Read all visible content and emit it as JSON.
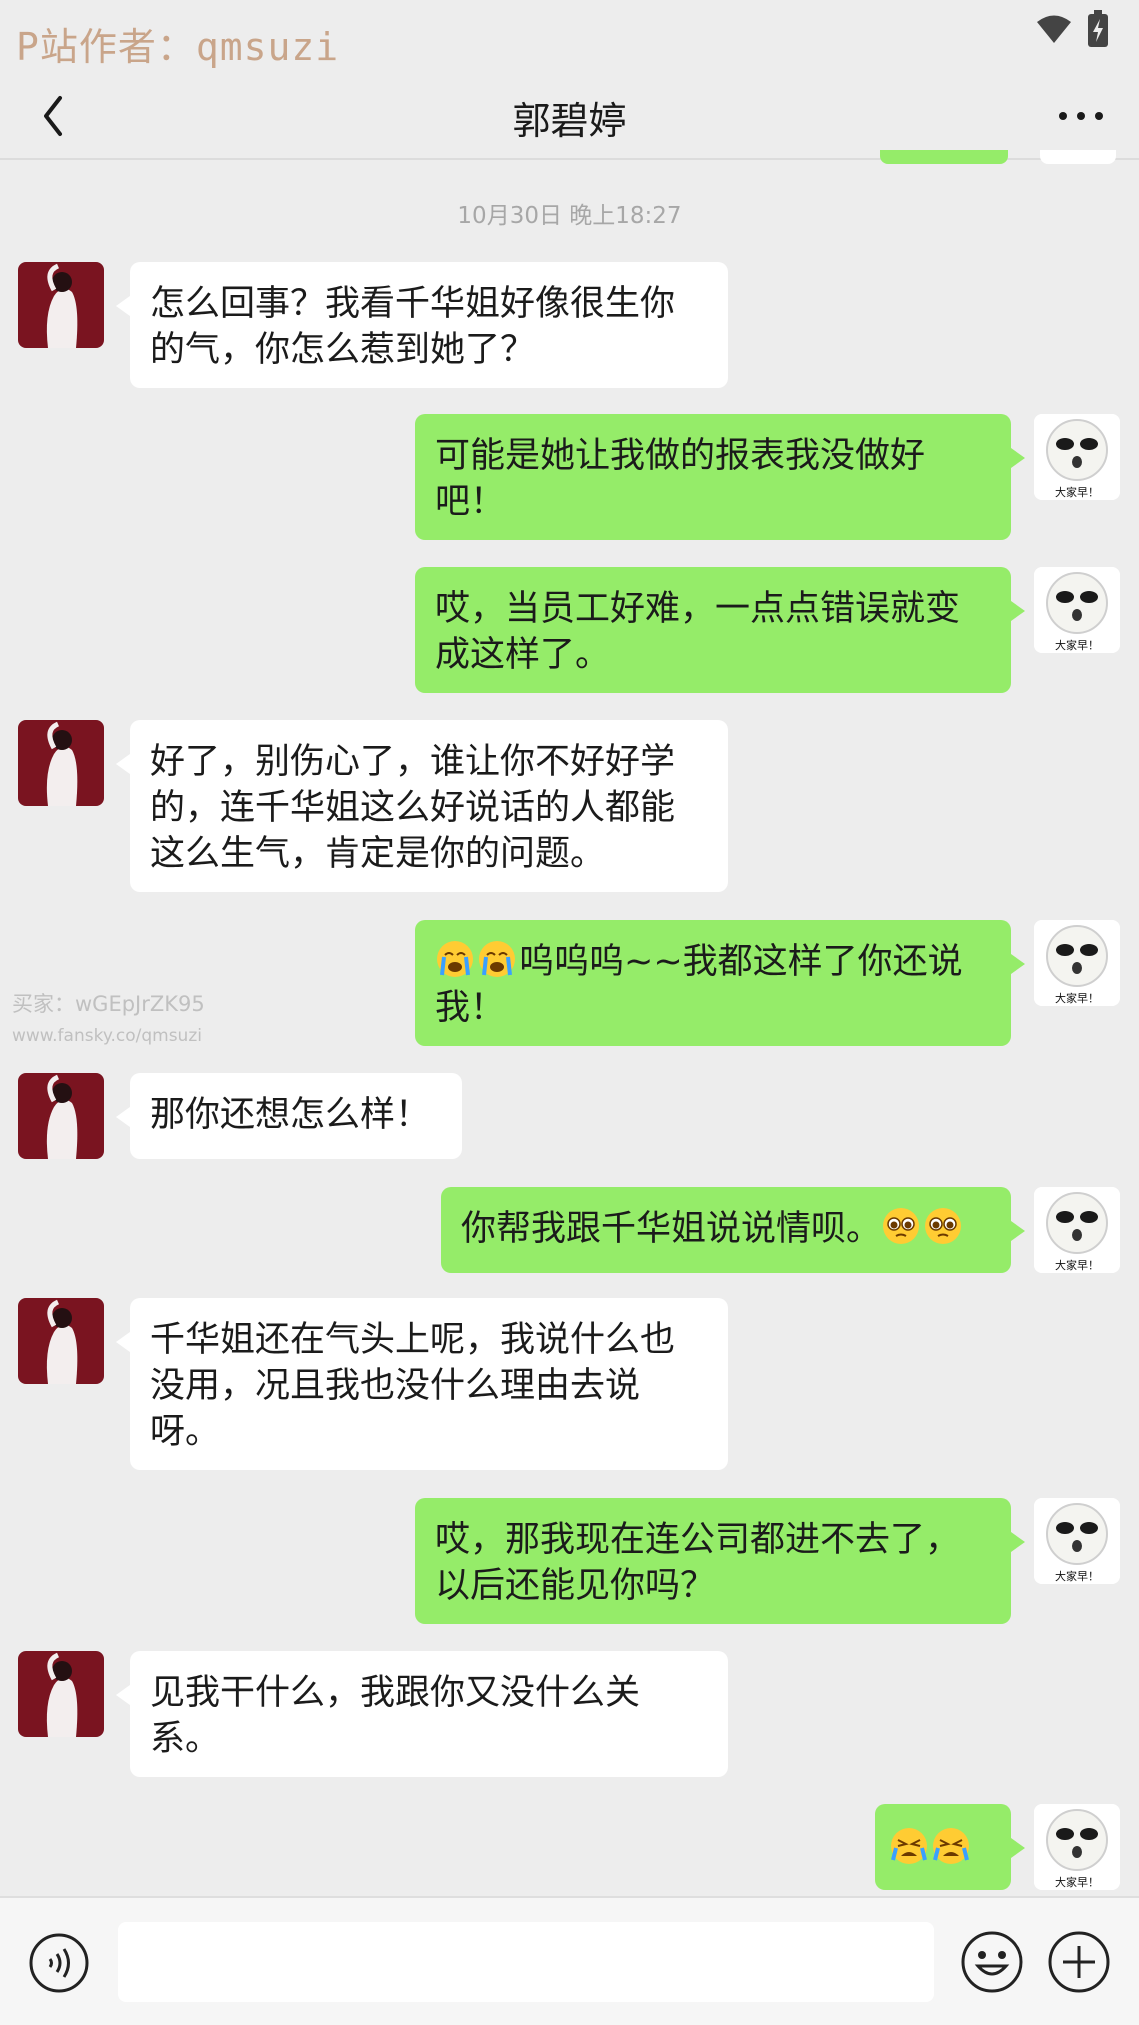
{
  "status_bar": {
    "watermark": "P站作者：qmsuzi",
    "icons": [
      "wifi-icon",
      "battery-charging-icon"
    ]
  },
  "header": {
    "title": "郭碧婷",
    "back_icon": "chevron-left-icon",
    "more_icon": "more-horizontal-icon"
  },
  "timestamp": "10月30日 晚上18:27",
  "watermark_mid": {
    "line1": "买家：wGEpJrZK95",
    "line2": "www.fansky.co/qmsuzi"
  },
  "messages": [
    {
      "side": "in",
      "text": "怎么回事？我看千华姐好像很生你的气，你怎么惹到她了？"
    },
    {
      "side": "out",
      "text": "可能是她让我做的报表我没做好吧！",
      "avatar_caption": "大家早！"
    },
    {
      "side": "out",
      "text": "哎，当员工好难，一点点错误就变成这样了。",
      "avatar_caption": "大家早！"
    },
    {
      "side": "in",
      "text": "好了，别伤心了，谁让你不好好学的，连千华姐这么好说话的人都能这么生气，肯定是你的问题。"
    },
    {
      "side": "out",
      "emoji_before": [
        "crying-emoji",
        "crying-emoji"
      ],
      "text": "呜呜呜~~我都这样了你还说我！",
      "avatar_caption": "大家早！"
    },
    {
      "side": "in",
      "text": "那你还想怎么样！"
    },
    {
      "side": "out",
      "text": "你帮我跟千华姐说说情呗。",
      "emoji_after": [
        "pleading-emoji",
        "pleading-emoji"
      ],
      "avatar_caption": "大家早！"
    },
    {
      "side": "in",
      "text": "千华姐还在气头上呢，我说什么也没用，况且我也没什么理由去说呀。"
    },
    {
      "side": "out",
      "text": "哎，那我现在连公司都进不去了，以后还能见你吗？",
      "avatar_caption": "大家早！"
    },
    {
      "side": "in",
      "text": "见我干什么，我跟你又没什么关系。"
    },
    {
      "side": "out",
      "emoji_only": [
        "sobbing-emoji",
        "sobbing-emoji"
      ],
      "avatar_caption": "大家早！"
    }
  ],
  "input_bar": {
    "voice_icon": "voice-icon",
    "text_value": "",
    "emoji_icon": "smiley-icon",
    "plus_icon": "plus-circle-icon"
  },
  "colors": {
    "background": "#ededed",
    "bubble_out": "#95ec69",
    "bubble_in": "#ffffff",
    "watermark_top": "#c9a58a"
  }
}
